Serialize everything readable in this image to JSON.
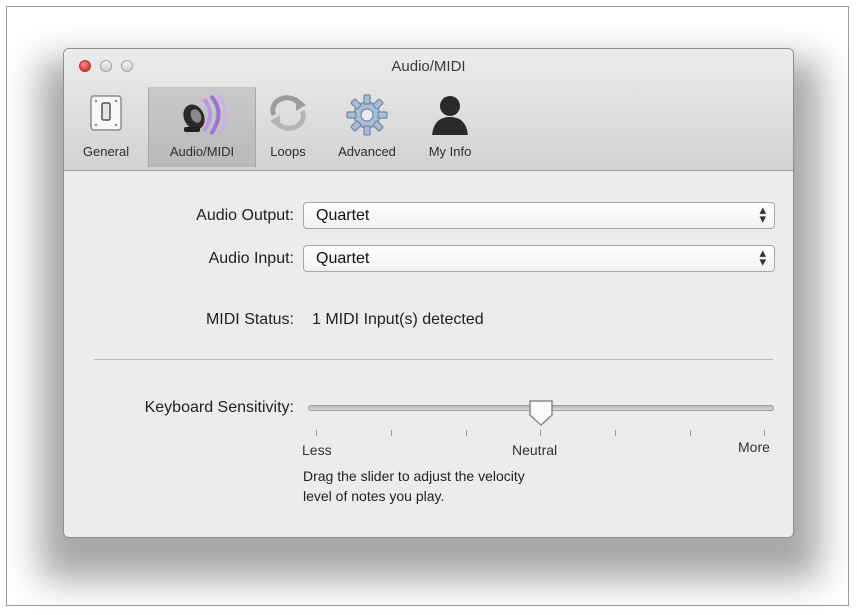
{
  "window": {
    "title": "Audio/MIDI"
  },
  "toolbar": {
    "items": [
      {
        "label": "General",
        "icon": "switch-icon"
      },
      {
        "label": "Audio/MIDI",
        "icon": "speaker-icon",
        "selected": true
      },
      {
        "label": "Loops",
        "icon": "loop-arrows-icon"
      },
      {
        "label": "Advanced",
        "icon": "gear-icon"
      },
      {
        "label": "My Info",
        "icon": "person-icon"
      }
    ]
  },
  "audio": {
    "output_label": "Audio Output:",
    "output_value": "Quartet",
    "input_label": "Audio Input:",
    "input_value": "Quartet"
  },
  "midi": {
    "status_label": "MIDI Status:",
    "status_value": "1 MIDI Input(s) detected"
  },
  "sensitivity": {
    "label": "Keyboard Sensitivity:",
    "less": "Less",
    "neutral": "Neutral",
    "more": "More",
    "value": 0.5,
    "help_line1": "Drag the slider to adjust the velocity",
    "help_line2": "level of notes you play."
  },
  "colors": {
    "close_button": "#e0443a",
    "accent_speaker": "#a072d6"
  }
}
